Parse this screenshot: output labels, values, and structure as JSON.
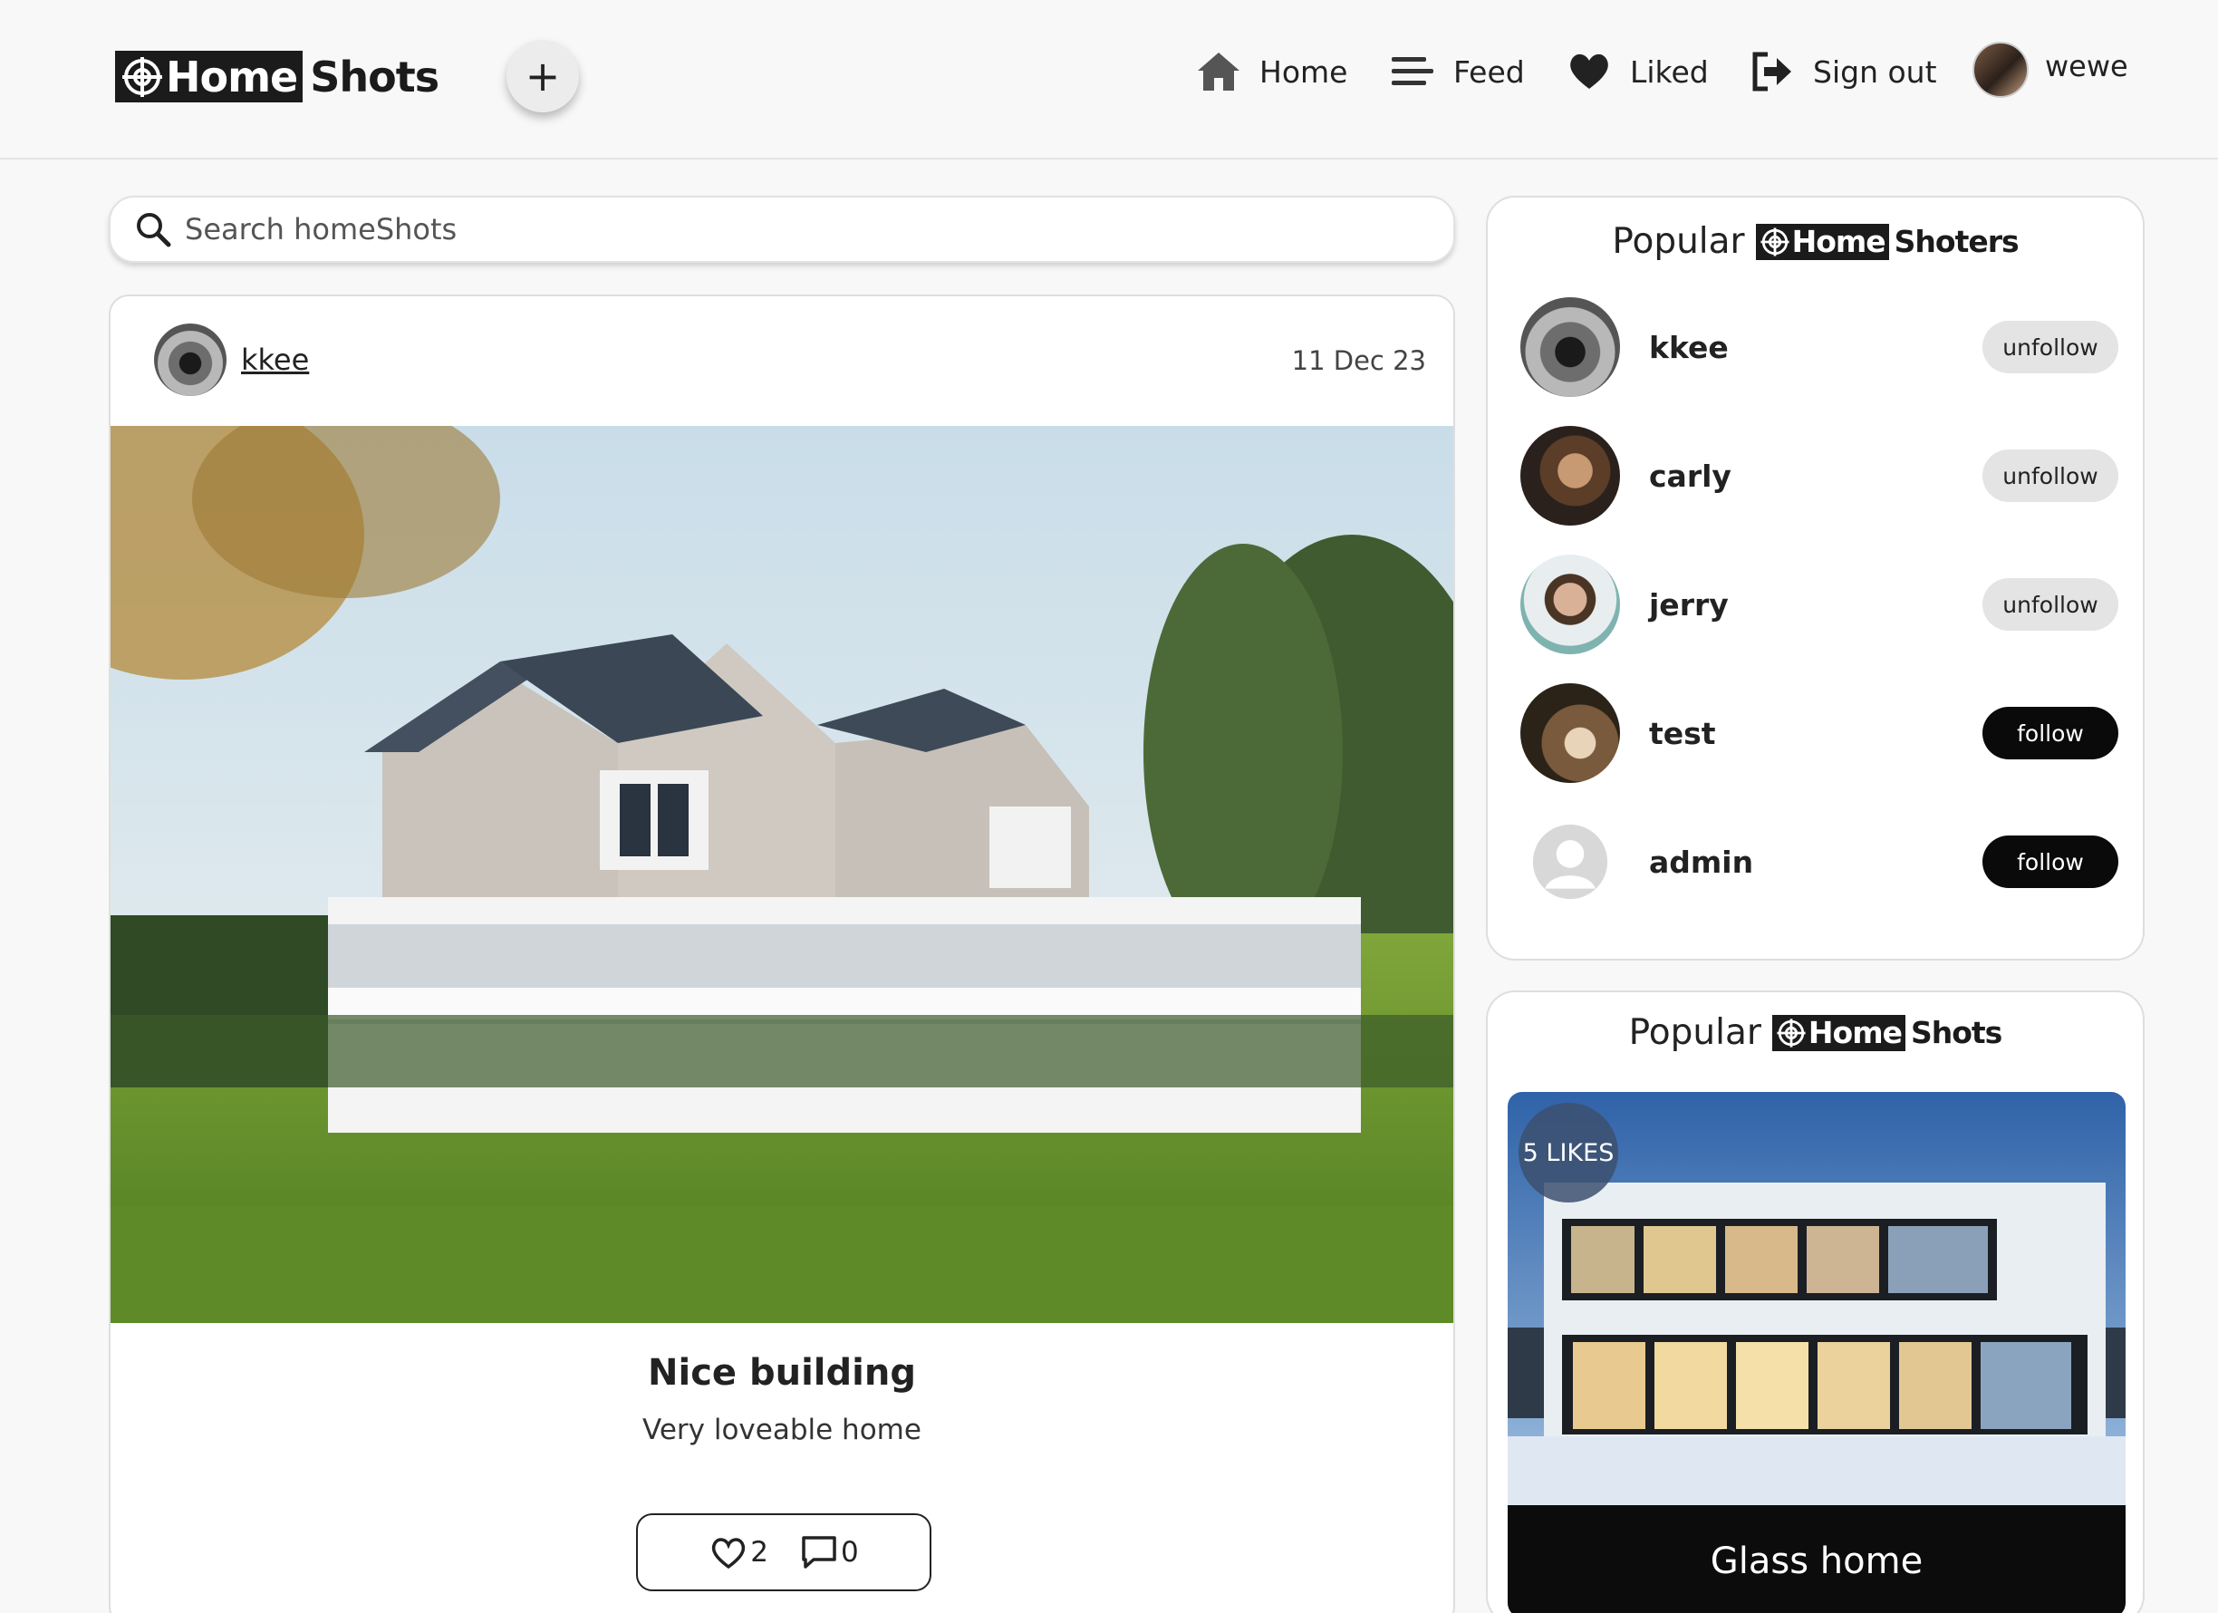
{
  "brand": {
    "logo_bold": "Home",
    "logo_rest": "Shots"
  },
  "header": {
    "add_label": "+",
    "nav": {
      "home": "Home",
      "feed": "Feed",
      "liked": "Liked",
      "signout": "Sign out"
    },
    "user": "wewe"
  },
  "search": {
    "placeholder": "Search homeShots"
  },
  "post": {
    "user": "kkee",
    "date": "11 Dec 23",
    "title": "Nice building",
    "description": "Very loveable home",
    "likes": "2",
    "comments": "0"
  },
  "popular_shooters": {
    "title_prefix": "Popular",
    "logo_bold": "Home",
    "logo_rest": "Shoters",
    "items": [
      {
        "name": "kkee",
        "action": "unfollow"
      },
      {
        "name": "carly",
        "action": "unfollow"
      },
      {
        "name": "jerry",
        "action": "unfollow"
      },
      {
        "name": "test",
        "action": "follow"
      },
      {
        "name": "admin",
        "action": "follow"
      }
    ]
  },
  "popular_shots": {
    "title_prefix": "Popular",
    "logo_bold": "Home",
    "logo_rest": "Shots",
    "items": [
      {
        "title": "Glass home",
        "likes": "5 LIKES"
      }
    ]
  }
}
